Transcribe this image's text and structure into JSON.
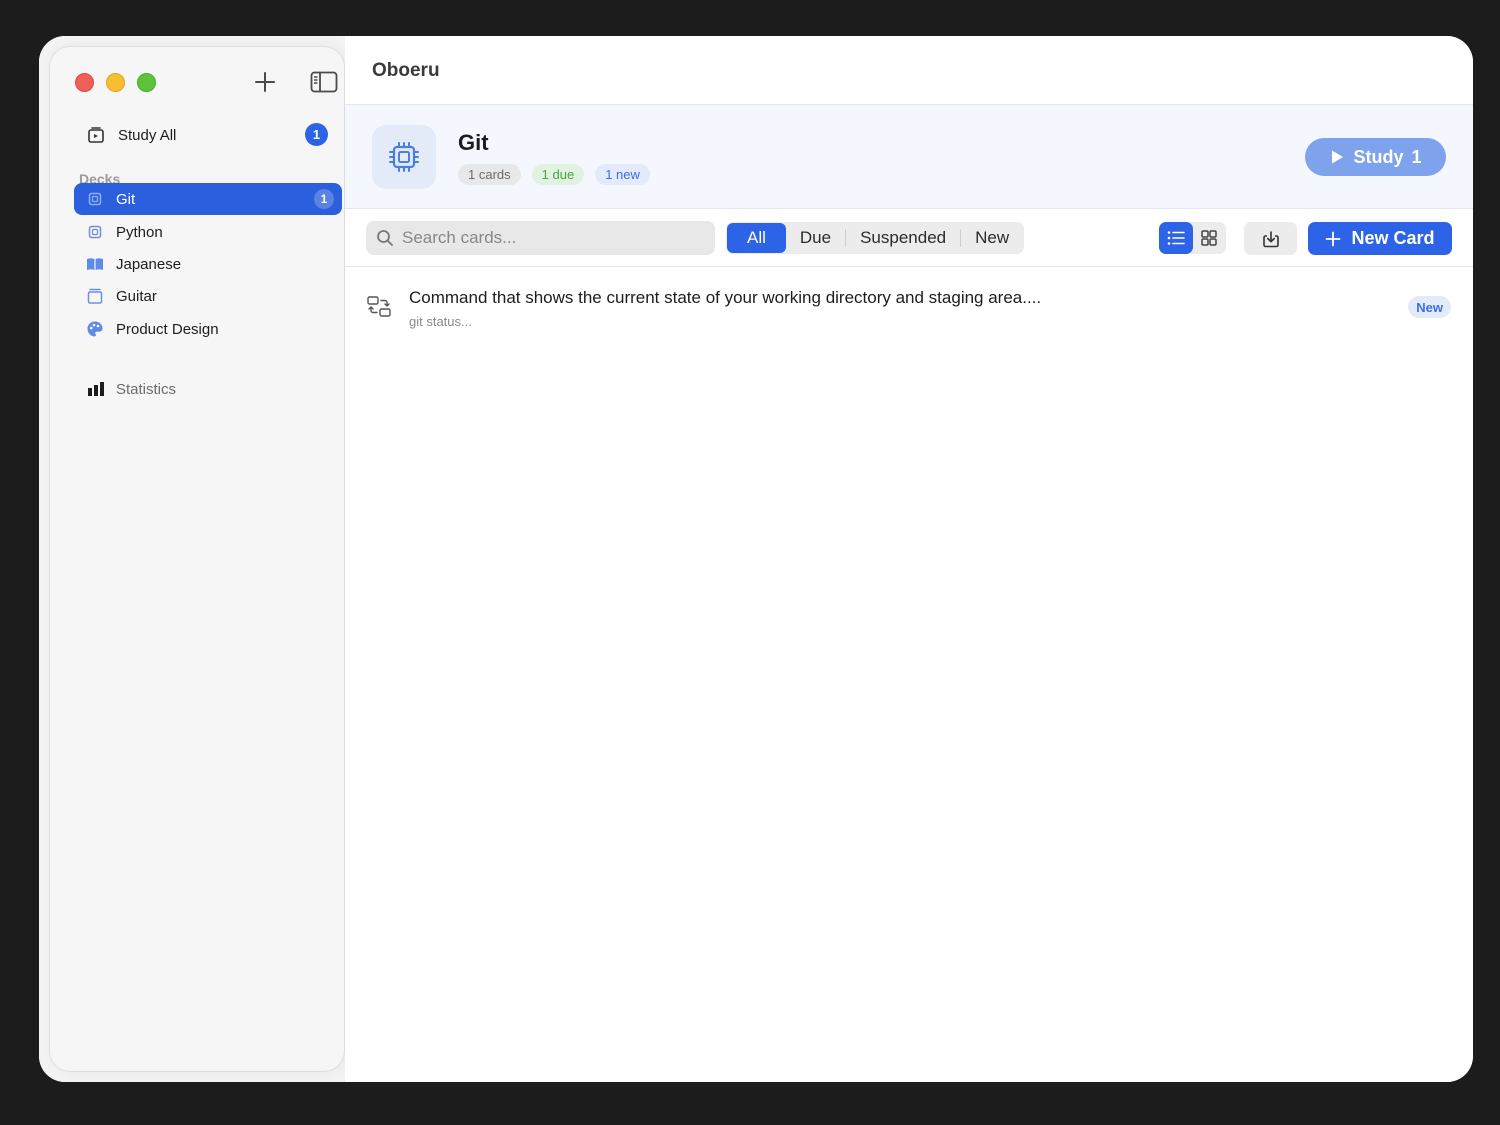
{
  "app": {
    "title": "Oboeru"
  },
  "sidebar": {
    "study_all_label": "Study All",
    "study_all_count": "1",
    "decks_header": "Decks",
    "decks": [
      {
        "label": "Git",
        "count": "1",
        "icon": "chip-icon"
      },
      {
        "label": "Python",
        "icon": "chip-icon"
      },
      {
        "label": "Japanese",
        "icon": "book-icon"
      },
      {
        "label": "Guitar",
        "icon": "box-icon"
      },
      {
        "label": "Product Design",
        "icon": "palette-icon"
      }
    ],
    "statistics_label": "Statistics"
  },
  "deck": {
    "name": "Git",
    "cards_pill": "1 cards",
    "due_pill": "1 due",
    "new_pill": "1 new",
    "study_label": "Study",
    "study_count": "1"
  },
  "toolbar": {
    "search_placeholder": "Search cards...",
    "filters": [
      "All",
      "Due",
      "Suspended",
      "New"
    ],
    "active_filter": "All",
    "new_card_label": "New Card"
  },
  "cards": [
    {
      "front": "Command that shows the current state of your working directory and staging area....",
      "back": "git status...",
      "status": "New"
    }
  ],
  "colors": {
    "accent": "#2d63e6",
    "study_button": "#7ea3ec",
    "due_green": "#44a544"
  }
}
